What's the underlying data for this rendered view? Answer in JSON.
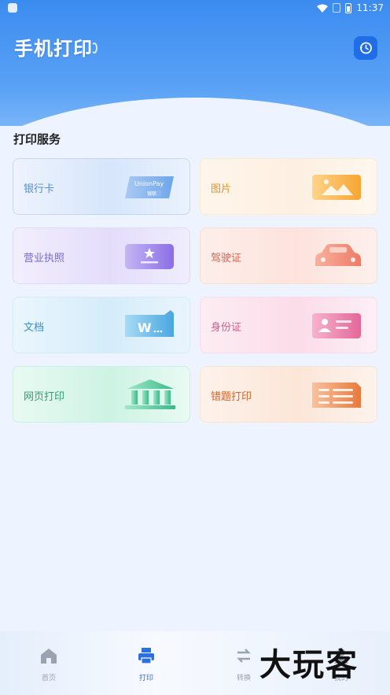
{
  "status_bar": {
    "time": "11:37"
  },
  "header": {
    "title": "手机打印"
  },
  "section": {
    "title": "打印服务"
  },
  "services": [
    {
      "label": "银行卡",
      "color": "#5a8fc8",
      "icon": "bank-card-icon",
      "art_text": "UnionPay",
      "art_sub": "银联"
    },
    {
      "label": "图片",
      "color": "#e3912a",
      "icon": "image-icon"
    },
    {
      "label": "营业执照",
      "color": "#7a6ad0",
      "icon": "license-icon"
    },
    {
      "label": "驾驶证",
      "color": "#d8664e",
      "icon": "car-icon"
    },
    {
      "label": "文档",
      "color": "#3a8fc7",
      "icon": "document-icon",
      "art_text": "W"
    },
    {
      "label": "身份证",
      "color": "#d45c8c",
      "icon": "id-card-icon"
    },
    {
      "label": "网页打印",
      "color": "#2f9c76",
      "icon": "webpage-icon"
    },
    {
      "label": "错题打印",
      "color": "#d0652c",
      "icon": "wrong-question-icon"
    }
  ],
  "nav": [
    {
      "label": "首页",
      "icon": "home-icon"
    },
    {
      "label": "打印",
      "icon": "printer-icon",
      "active": true
    },
    {
      "label": "转换",
      "icon": "convert-icon"
    },
    {
      "label": "我的",
      "icon": "profile-icon"
    }
  ],
  "watermark": "大玩客"
}
